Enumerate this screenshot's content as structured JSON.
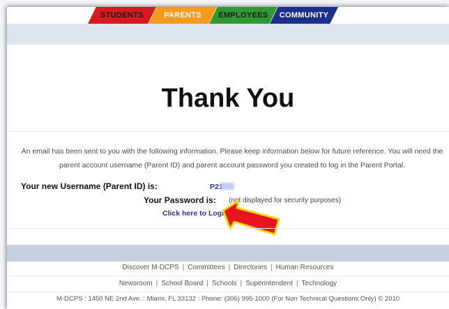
{
  "nav": {
    "tabs": [
      {
        "label": "STUDENTS",
        "bg": "#d71920",
        "color": "#1a1a1a"
      },
      {
        "label": "PARENTS",
        "bg": "#f59a1b",
        "color": "#ffffff"
      },
      {
        "label": "EMPLOYEES",
        "bg": "#2f9a32",
        "color": "#1a1a1a"
      },
      {
        "label": "COMMUNITY",
        "bg": "#1c2f8f",
        "color": "#ffffff"
      }
    ]
  },
  "main": {
    "heading": "Thank You",
    "message": "An email has been sent to you with the following information. Please keep information below for future reference. You will need the parent account username (Parent ID) and parent account password you created to log in the Parent Portal.",
    "username_label": "Your new Username (Parent ID) is:",
    "username_value": "P21",
    "password_label": "Your Password is:",
    "password_value": "(not displayed for security purposes)",
    "login_link": "Click here to Login"
  },
  "annotation": {
    "icon": "red-arrow-icon",
    "color": "#e8141e",
    "outline": "#f4d51a"
  },
  "footer": {
    "links_row1": [
      "Discover M-DCPS",
      "Committees",
      "Directories",
      "Human Resources"
    ],
    "links_row2": [
      "Newsroom",
      "School Board",
      "Schools",
      "Superintendent",
      "Technology"
    ],
    "copyright": "M-DCPS : 1450 NE 2nd Ave. : Miami, FL 33132 : Phone: (305) 995-1000 (For Non Technical Questions Only) © 2010"
  }
}
